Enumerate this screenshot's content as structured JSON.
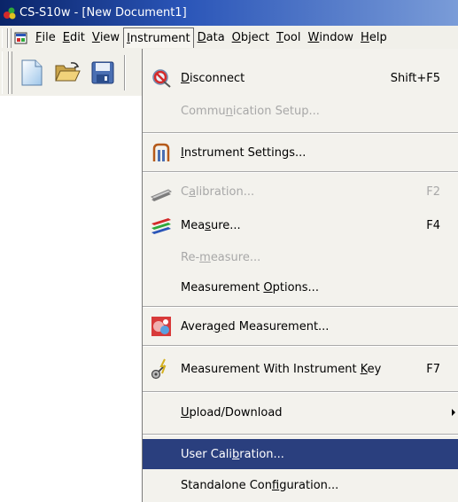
{
  "window": {
    "title": "CS-S10w - [New Document1]"
  },
  "menubar": {
    "items": [
      {
        "key": "file",
        "pre": "",
        "acc": "F",
        "post": "ile"
      },
      {
        "key": "edit",
        "pre": "",
        "acc": "E",
        "post": "dit"
      },
      {
        "key": "view",
        "pre": "",
        "acc": "V",
        "post": "iew"
      },
      {
        "key": "instrument",
        "pre": "",
        "acc": "I",
        "post": "nstrument"
      },
      {
        "key": "data",
        "pre": "",
        "acc": "D",
        "post": "ata"
      },
      {
        "key": "object",
        "pre": "",
        "acc": "O",
        "post": "bject"
      },
      {
        "key": "tool",
        "pre": "",
        "acc": "T",
        "post": "ool"
      },
      {
        "key": "window",
        "pre": "",
        "acc": "W",
        "post": "indow"
      },
      {
        "key": "help",
        "pre": "",
        "acc": "H",
        "post": "elp"
      }
    ]
  },
  "toolbar": {
    "buttons": [
      "new-document-icon",
      "open-folder-icon",
      "save-disk-icon"
    ]
  },
  "instrument_menu": {
    "items": [
      {
        "pre": "",
        "acc": "D",
        "post": "isconnect",
        "shortcut": "Shift+F5",
        "enabled": true,
        "icon": "disconnect-icon"
      },
      {
        "pre": "Commu",
        "acc": "n",
        "post": "ication Setup...",
        "shortcut": "",
        "enabled": false,
        "icon": ""
      },
      {
        "pre": "",
        "acc": "I",
        "post": "nstrument Settings...",
        "shortcut": "",
        "enabled": true,
        "icon": "instrument-settings-icon"
      },
      {
        "pre": "C",
        "acc": "a",
        "post": "libration...",
        "shortcut": "F2",
        "enabled": false,
        "icon": "calibration-icon"
      },
      {
        "pre": "Mea",
        "acc": "s",
        "post": "ure...",
        "shortcut": "F4",
        "enabled": true,
        "icon": "measure-icon"
      },
      {
        "pre": "Re-",
        "acc": "m",
        "post": "easure...",
        "shortcut": "",
        "enabled": false,
        "icon": ""
      },
      {
        "pre": "Measurement ",
        "acc": "O",
        "post": "ptions...",
        "shortcut": "",
        "enabled": true,
        "icon": ""
      },
      {
        "pre": "Avera",
        "acc": "g",
        "post": "ed Measurement...",
        "shortcut": "",
        "enabled": true,
        "icon": "averaged-measurement-icon"
      },
      {
        "pre": "Measurement With Instrument ",
        "acc": "K",
        "post": "ey",
        "shortcut": "F7",
        "enabled": true,
        "icon": "instrument-key-icon"
      },
      {
        "pre": "",
        "acc": "U",
        "post": "pload/Download",
        "shortcut": "",
        "enabled": true,
        "icon": "",
        "submenu": true
      },
      {
        "pre": "User Cali",
        "acc": "b",
        "post": "ration...",
        "shortcut": "",
        "enabled": true,
        "icon": "",
        "selected": true
      },
      {
        "pre": "Standalone Con",
        "acc": "f",
        "post": "iguration...",
        "shortcut": "",
        "enabled": true,
        "icon": ""
      }
    ]
  }
}
